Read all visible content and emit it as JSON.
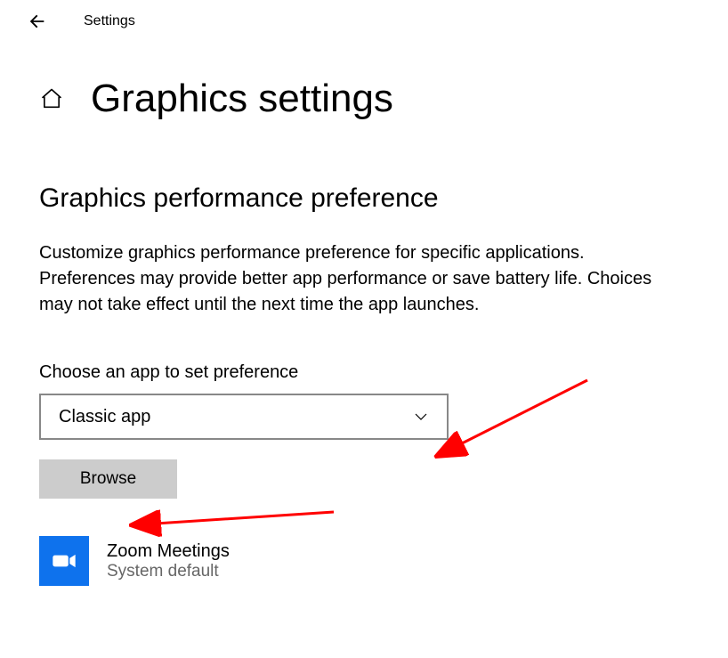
{
  "header": {
    "settings_label": "Settings"
  },
  "title": "Graphics settings",
  "section": {
    "heading": "Graphics performance preference",
    "description": "Customize graphics performance preference for specific applications. Preferences may provide better app performance or save battery life. Choices may not take effect until the next time the app launches."
  },
  "choose": {
    "label": "Choose an app to set preference",
    "dropdown_value": "Classic app",
    "browse_label": "Browse"
  },
  "applist": {
    "items": [
      {
        "name": "Zoom Meetings",
        "sub": "System default",
        "icon": "zoom"
      }
    ]
  }
}
